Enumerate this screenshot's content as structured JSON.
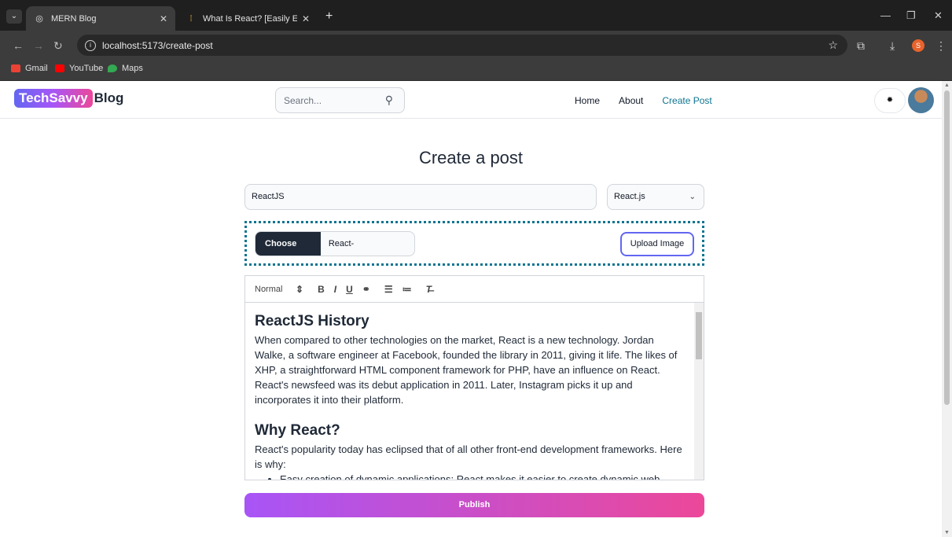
{
  "browser": {
    "tabs": [
      {
        "title": "MERN Blog",
        "active": true
      },
      {
        "title": "What Is React? [Easily Explained",
        "active": false
      }
    ],
    "url": "localhost:5173/create-post",
    "bookmarks": [
      "Gmail",
      "YouTube",
      "Maps"
    ],
    "profile_initial": "S"
  },
  "header": {
    "logo_brand": "TechSavvy",
    "logo_suffix": "Blog",
    "search_placeholder": "Search...",
    "nav": [
      "Home",
      "About",
      "Create Post"
    ],
    "active_nav": "Create Post"
  },
  "form": {
    "page_title": "Create a post",
    "title_value": "ReactJS",
    "category_value": "React.js",
    "choose_file_label": "Choose file",
    "file_name": "React-Fro...guage.png",
    "upload_label": "Upload Image",
    "editor": {
      "format": "Normal",
      "heading1": "ReactJS History",
      "paragraph1": "When compared to other technologies on the market, React is a new technology. Jordan Walke, a software engineer at Facebook, founded the library in 2011, giving it life. The likes of XHP, a straightforward HTML component framework for PHP, have an influence on React. React's newsfeed was its debut application in 2011. Later, Instagram picks it up and incorporates it into their platform.",
      "heading2": "Why React?",
      "paragraph2": "React's popularity today has eclipsed that of all other front-end development frameworks. Here is why:",
      "bullet1": "Easy creation of dynamic applications: React makes it easier to create dynamic web"
    },
    "publish_label": "Publish"
  },
  "colors": {
    "accent": "#0e7490",
    "gradient_start": "#a855f7",
    "gradient_end": "#ec4899"
  }
}
